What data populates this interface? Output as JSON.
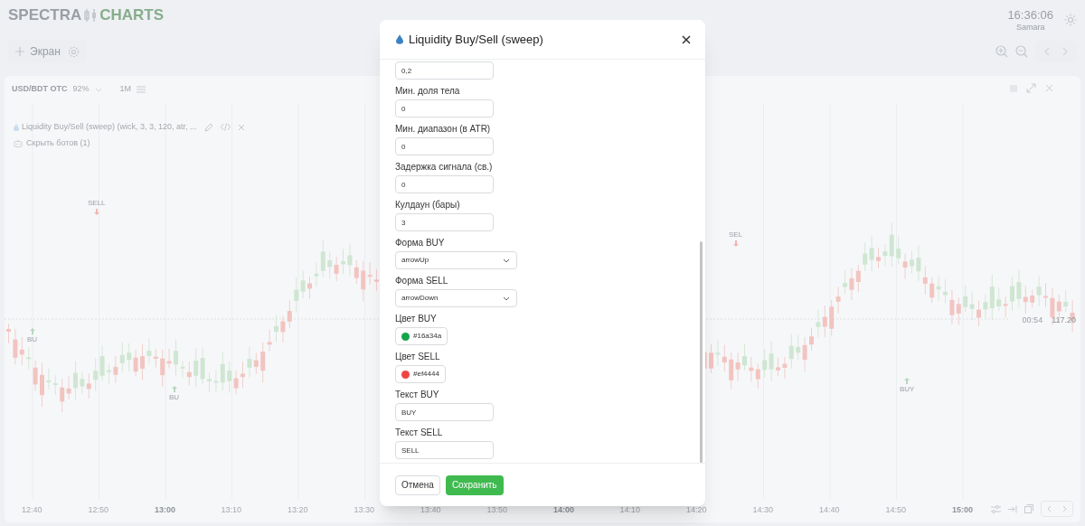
{
  "header": {
    "logo_left": "SPECTRA",
    "logo_right": "CHARTS",
    "clock": "16:36:06",
    "city": "Samara"
  },
  "toolbar": {
    "add_screen": "Экран"
  },
  "chart_panel": {
    "symbol": "USD/BDT OTC",
    "payout": "92%",
    "timeframe": "1M",
    "indicator": "Liquidity Buy/Sell (sweep) (wick, 3, 3, 120, atr, ...",
    "bots": "Скрыть ботов (1)",
    "signals": [
      {
        "kind": "sell",
        "text": "SELL"
      },
      {
        "kind": "buy",
        "text": "BU"
      },
      {
        "kind": "buy",
        "text": "BU"
      },
      {
        "kind": "sell",
        "text": "SEL"
      },
      {
        "kind": "buy",
        "text": "BUY"
      }
    ],
    "price_labels": [
      "00:54",
      "117.20"
    ],
    "time_axis": [
      {
        "label": "12:40",
        "bold": false
      },
      {
        "label": "12:50",
        "bold": false
      },
      {
        "label": "13:00",
        "bold": true
      },
      {
        "label": "13:10",
        "bold": false
      },
      {
        "label": "13:20",
        "bold": false
      },
      {
        "label": "13:30",
        "bold": false
      },
      {
        "label": "13:40",
        "bold": false
      },
      {
        "label": "13:50",
        "bold": false
      },
      {
        "label": "14:00",
        "bold": true
      },
      {
        "label": "14:10",
        "bold": false
      },
      {
        "label": "14:20",
        "bold": false
      },
      {
        "label": "14:30",
        "bold": false
      },
      {
        "label": "14:40",
        "bold": false
      },
      {
        "label": "14:50",
        "bold": false
      },
      {
        "label": "15:00",
        "bold": true
      }
    ]
  },
  "modal": {
    "title": "Liquidity Buy/Sell (sweep)",
    "fields": [
      {
        "kind": "input",
        "value": "0,2"
      },
      {
        "kind": "input",
        "label": "Мин. доля тела",
        "value": "0"
      },
      {
        "kind": "input",
        "label": "Мин. диапазон (в ATR)",
        "value": "0"
      },
      {
        "kind": "input",
        "label": "Задержка сигнала (св.)",
        "value": "0"
      },
      {
        "kind": "input",
        "label": "Кулдаун (бары)",
        "value": "3"
      },
      {
        "kind": "select",
        "label": "Форма BUY",
        "value": "arrowUp"
      },
      {
        "kind": "select",
        "label": "Форма SELL",
        "value": "arrowDown"
      },
      {
        "kind": "color",
        "label": "Цвет BUY",
        "value": "#16a34a",
        "color": "#16a34a"
      },
      {
        "kind": "color",
        "label": "Цвет SELL",
        "value": "#ef4444",
        "color": "#ef4444"
      },
      {
        "kind": "input",
        "label": "Текст BUY",
        "value": "BUY"
      },
      {
        "kind": "input",
        "label": "Текст SELL",
        "value": "SELL"
      }
    ],
    "buttons": [
      {
        "kind": "secondary",
        "label": "Отмена"
      },
      {
        "kind": "primary",
        "label": "Сохранить"
      }
    ]
  }
}
